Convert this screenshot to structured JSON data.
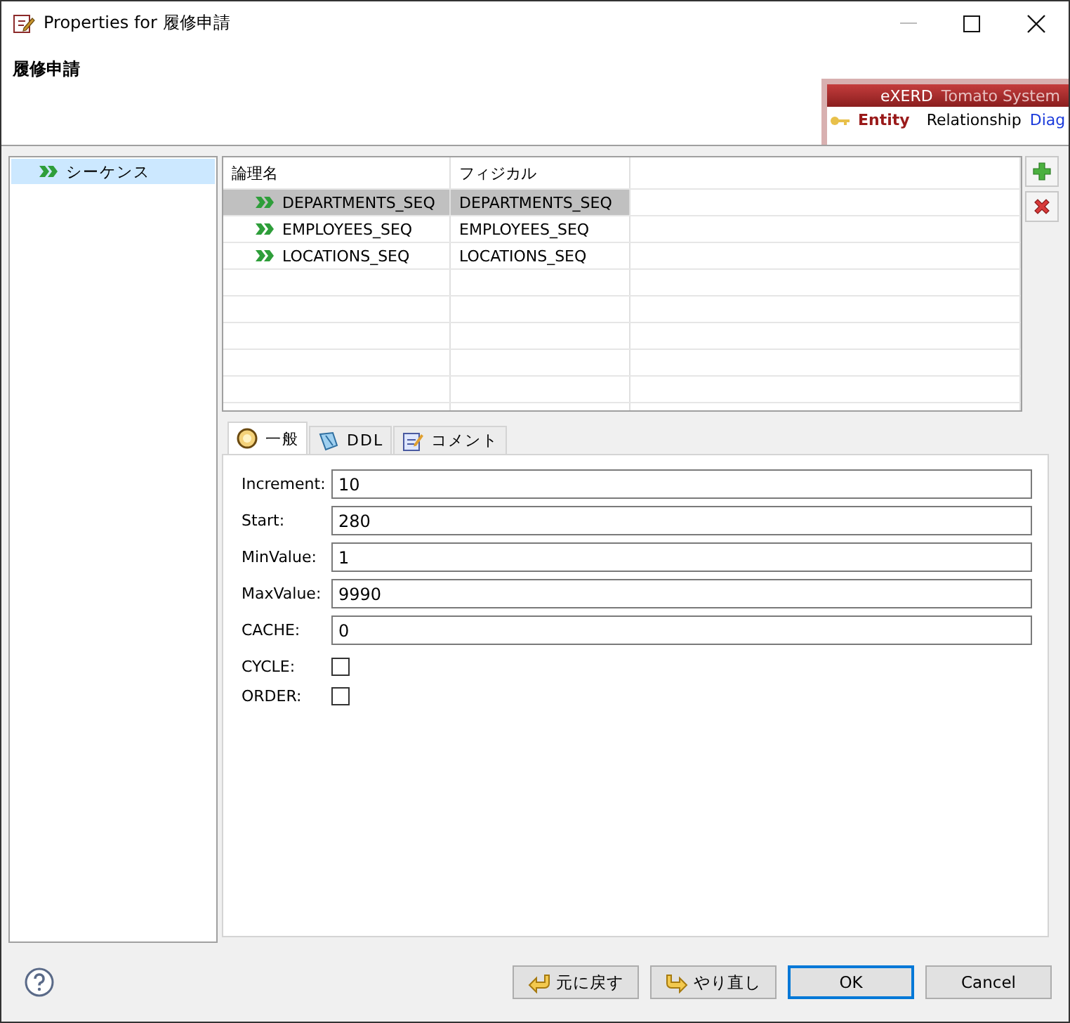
{
  "window": {
    "title": "Properties for 履修申請"
  },
  "header": {
    "title": "履修申請"
  },
  "banner": {
    "brand": "eXERD",
    "product": "Tomato System",
    "links": [
      {
        "label": "Entity",
        "kind": "active"
      },
      {
        "label": "Relationship",
        "kind": "plain"
      },
      {
        "label": "Diag",
        "kind": "link"
      }
    ]
  },
  "sidebar": {
    "items": [
      {
        "label": "シーケンス",
        "selected": true
      }
    ]
  },
  "table": {
    "columns": [
      "論理名",
      "フィジカル"
    ],
    "rows": [
      {
        "cells": [
          "DEPARTMENTS_SEQ",
          "DEPARTMENTS_SEQ"
        ],
        "selected": true
      },
      {
        "cells": [
          "EMPLOYEES_SEQ",
          "EMPLOYEES_SEQ"
        ],
        "selected": false
      },
      {
        "cells": [
          "LOCATIONS_SEQ",
          "LOCATIONS_SEQ"
        ],
        "selected": false
      }
    ]
  },
  "tabs": [
    {
      "label": "一般",
      "kind": "general",
      "selected": true
    },
    {
      "label": "DDL",
      "kind": "ddl",
      "selected": false
    },
    {
      "label": "コメント",
      "kind": "comment",
      "selected": false
    }
  ],
  "fields": [
    {
      "kind": "text",
      "label": "Increment:",
      "value": "10"
    },
    {
      "kind": "text",
      "label": "Start:",
      "value": "280"
    },
    {
      "kind": "text",
      "label": "MinValue:",
      "value": "1"
    },
    {
      "kind": "text",
      "label": "MaxValue:",
      "value": "9990"
    },
    {
      "kind": "text",
      "label": "CACHE:",
      "value": "0"
    },
    {
      "kind": "checkbox",
      "label": "CYCLE:",
      "checked": false
    },
    {
      "kind": "checkbox",
      "label": "ORDER:",
      "checked": false
    }
  ],
  "buttons": [
    {
      "label": "元に戻す",
      "kind": "undo",
      "default": false
    },
    {
      "label": "やり直し",
      "kind": "redo",
      "default": false
    },
    {
      "label": "OK",
      "kind": "plain",
      "default": true
    },
    {
      "label": "Cancel",
      "kind": "plain",
      "default": false
    }
  ]
}
